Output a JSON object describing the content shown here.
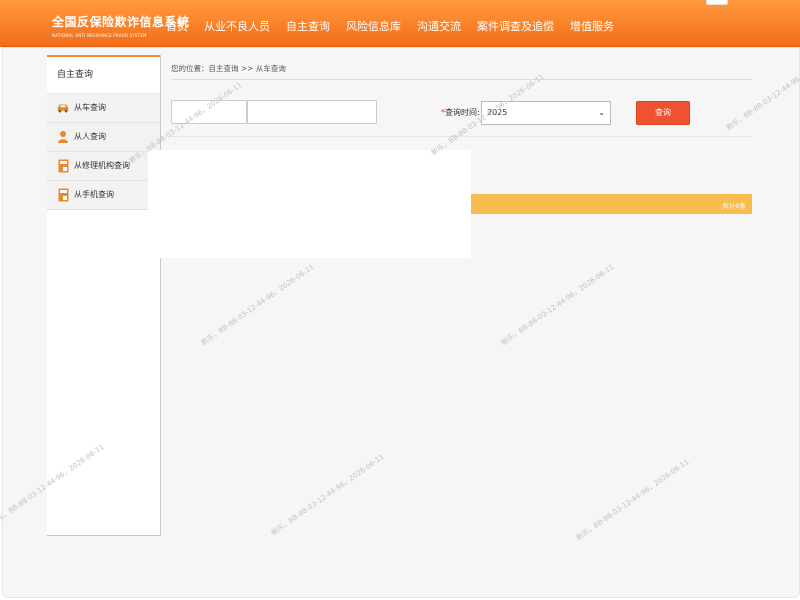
{
  "header": {
    "logo_cn": "全国反保险欺诈信息系统",
    "logo_en": "NATIONAL ANTI INSURANCE FRAUD SYSTEM",
    "nav": [
      "首页",
      "从业不良人员",
      "自主查询",
      "风险信息库",
      "沟通交流",
      "案件调查及追偿",
      "增值服务"
    ]
  },
  "sidebar": {
    "title": "自主查询",
    "items": [
      {
        "label": "从车查询",
        "icon": "car-icon"
      },
      {
        "label": "从人查询",
        "icon": "person-icon"
      },
      {
        "label": "从修理机构查询",
        "icon": "document-icon"
      },
      {
        "label": "从手机查询",
        "icon": "document-icon"
      }
    ]
  },
  "main": {
    "breadcrumb": "您的位置：自主查询 >> 从车查询",
    "time_label": "查询时间:",
    "year": "2025",
    "query_button": "查询",
    "total": "共计0条"
  },
  "watermark": "新乐，BB-88-03-12-44-96，2026-06-11",
  "colors": {
    "header_orange": "#f58a32",
    "query_red": "#ef5230",
    "result_bar": "#f7bd4f"
  }
}
